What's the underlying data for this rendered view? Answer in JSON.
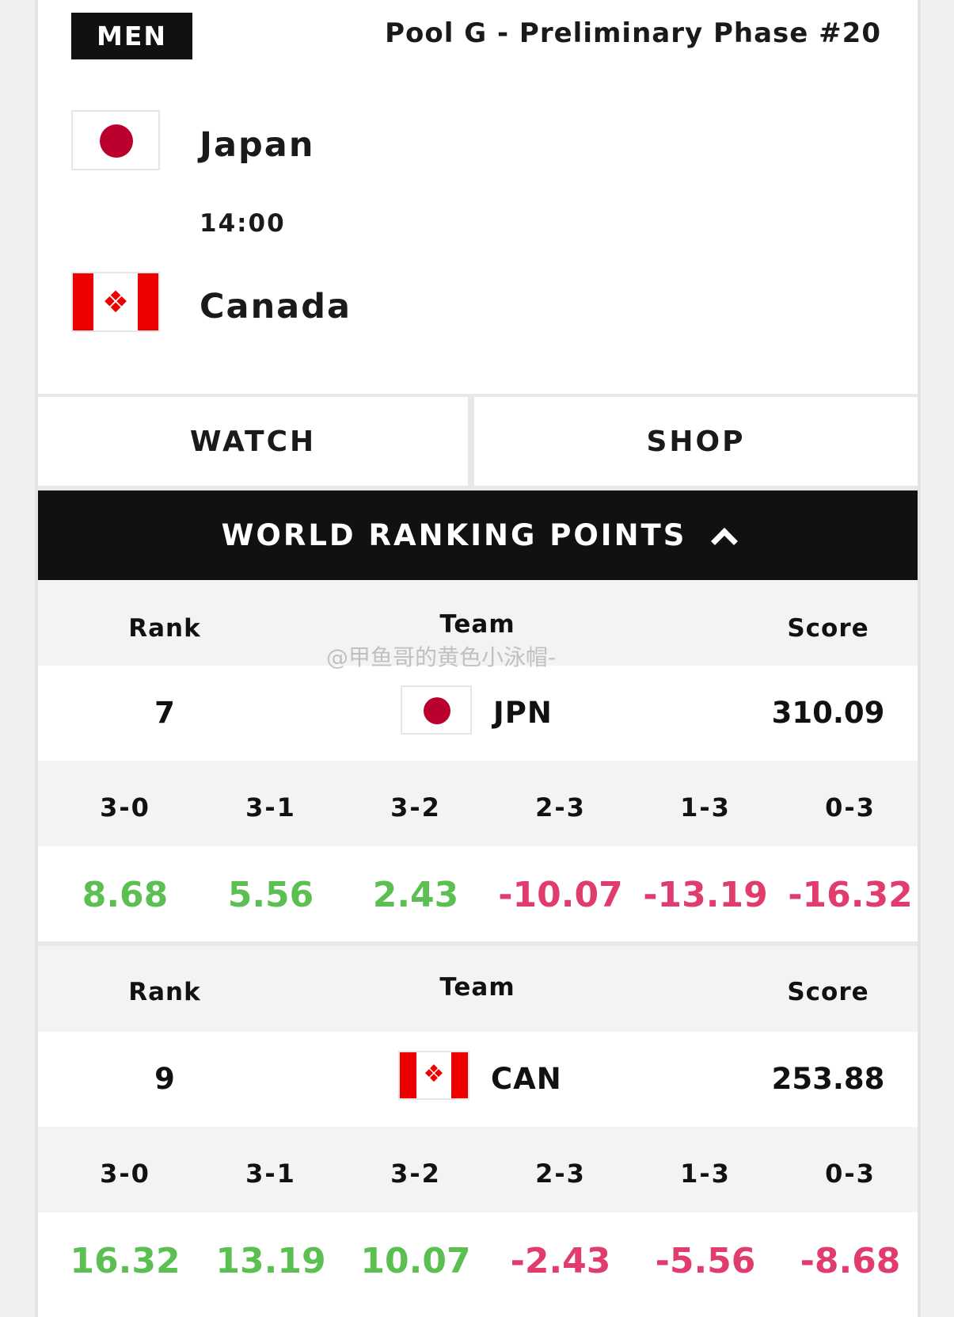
{
  "header": {
    "gender": "MEN",
    "phase": "Pool G - Preliminary Phase #20"
  },
  "match": {
    "home_team": "Japan",
    "time": "14:00",
    "away_team": "Canada"
  },
  "actions": {
    "watch": "WATCH",
    "shop": "SHOP"
  },
  "ranking": {
    "title": "WORLD RANKING POINTS",
    "columns": {
      "rank": "Rank",
      "team": "Team",
      "score": "Score"
    },
    "result_labels": [
      "3-0",
      "3-1",
      "3-2",
      "2-3",
      "1-3",
      "0-3"
    ],
    "teams": [
      {
        "rank": "7",
        "code": "JPN",
        "score": "310.09",
        "points": [
          "8.68",
          "5.56",
          "2.43",
          "-10.07",
          "-13.19",
          "-16.32"
        ]
      },
      {
        "rank": "9",
        "code": "CAN",
        "score": "253.88",
        "points": [
          "16.32",
          "13.19",
          "10.07",
          "-2.43",
          "-5.56",
          "-8.68"
        ]
      }
    ]
  },
  "watermark": "@甲鱼哥的黄色小泳帽-",
  "colors": {
    "positive": "#5cbf52",
    "negative": "#e03c6e",
    "bar": "#111111",
    "japan_red": "#bc002d",
    "canada_red": "#ee0000"
  }
}
